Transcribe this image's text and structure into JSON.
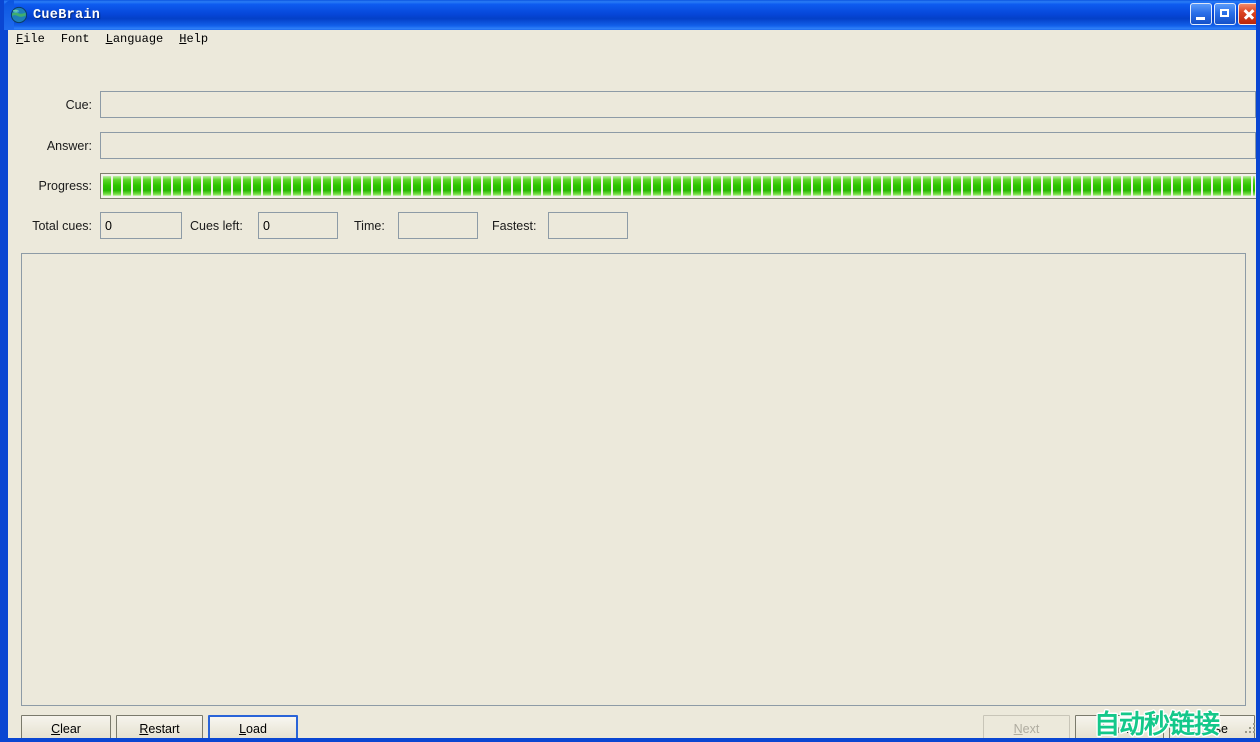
{
  "window": {
    "title": "CueBrain",
    "icon": "globe-icon",
    "accent_color": "#0A46D2",
    "titlebar_gradient_start": "#0B55E0",
    "titlebar_gradient_end": "#1F6BEE",
    "client_background": "#ECE9DB",
    "buttons": {
      "minimize": "minimize-icon",
      "maximize": "maximize-icon",
      "close": "close-icon"
    }
  },
  "menubar": {
    "items": [
      {
        "label": "File",
        "mnemonic": "F",
        "underlined": true
      },
      {
        "label": "Font",
        "mnemonic": "",
        "underlined": false
      },
      {
        "label": "Language",
        "mnemonic": "L",
        "underlined": true
      },
      {
        "label": "Help",
        "mnemonic": "H",
        "underlined": true
      }
    ]
  },
  "form": {
    "cue": {
      "label": "Cue:",
      "value": "",
      "placeholder": ""
    },
    "answer": {
      "label": "Answer:",
      "value": "",
      "placeholder": ""
    },
    "progress": {
      "label": "Progress:",
      "percent": 100,
      "fill_color": "#2EC400",
      "segment_style": "segmented"
    },
    "stats": [
      {
        "label": "Total cues:",
        "value": "0"
      },
      {
        "label": "Cues left:",
        "value": "0"
      },
      {
        "label": "Time:",
        "value": ""
      },
      {
        "label": "Fastest:",
        "value": ""
      }
    ]
  },
  "content": {
    "text": ""
  },
  "footer": {
    "left_buttons": [
      {
        "label": "Clear",
        "mnemonic": "C",
        "disabled": false,
        "default": false
      },
      {
        "label": "Restart",
        "mnemonic": "R",
        "disabled": false,
        "default": false
      },
      {
        "label": "Load",
        "mnemonic": "L",
        "disabled": false,
        "default": true
      }
    ],
    "right_buttons": [
      {
        "label": "Next",
        "mnemonic": "N",
        "disabled": true,
        "default": false
      },
      {
        "label": "Ignore",
        "mnemonic": "I",
        "disabled": false,
        "default": false
      },
      {
        "label": "Close",
        "mnemonic": "C",
        "disabled": false,
        "default": false
      }
    ]
  },
  "watermark": {
    "text": "自动秒链接",
    "color": "#14C88A"
  }
}
